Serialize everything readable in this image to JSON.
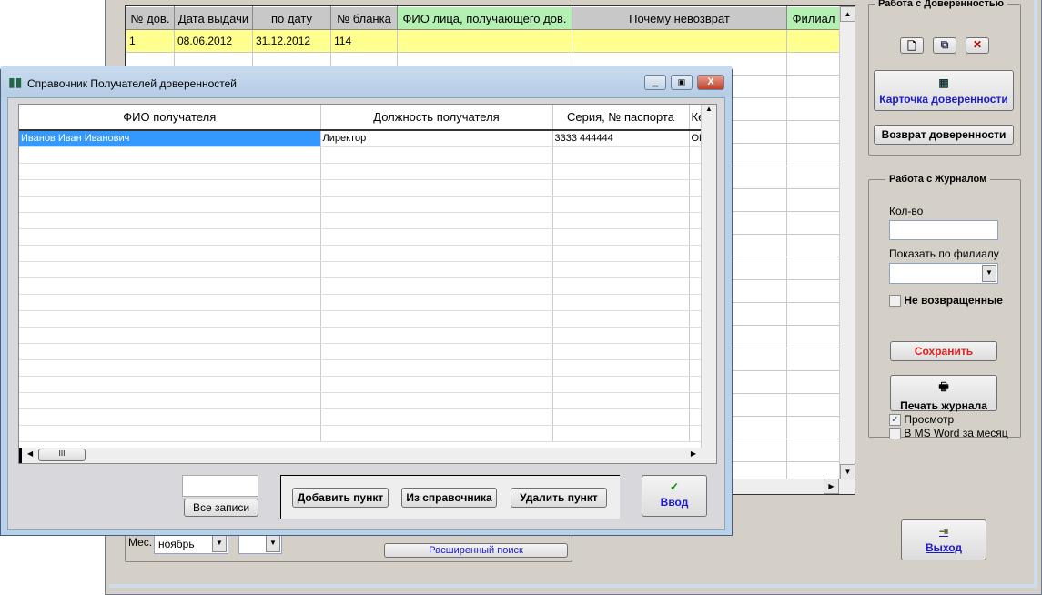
{
  "main": {
    "grid": {
      "columns": [
        "№ дов.",
        "Дата выдачи",
        "по дату",
        "№ бланка",
        "ФИО лица, получающего дов.",
        "Почему невозврат",
        "Филиал"
      ],
      "rows": [
        [
          "1",
          "08.06.2012",
          "31.12.2012",
          "114",
          "",
          "",
          ""
        ]
      ]
    },
    "group_poa": {
      "title": "Работа с Доверенностью",
      "card_label": "Карточка доверенности",
      "return_label": "Возврат доверенности"
    },
    "group_journal": {
      "title": "Работа с Журналом",
      "qty_label": "Кол-во",
      "qty_value": "",
      "branch_label": "Показать по филиалу",
      "branch_value": "",
      "not_returned_label": "Не возвращенные",
      "save_label": "Сохранить",
      "print_label": "Печать журнала",
      "preview_label": "Просмотр",
      "preview_checked": true,
      "word_label": "В MS Word за месяц",
      "word_checked": false
    },
    "exit_label": "Выход",
    "filter": {
      "month_label": "Мес.",
      "month_value": "ноябрь",
      "year_value": "",
      "advanced_search_label": "Расширенный поиск"
    },
    "colors": {
      "highlight_row": "#ffff90",
      "green_header": "#b4f0b4"
    }
  },
  "dialog": {
    "title": "Справочник Получателей доверенностей",
    "columns": [
      "ФИО получателя",
      "Должность получателя",
      "Серия, № паспорта",
      "Ке"
    ],
    "rows": [
      [
        "Иванов Иван Иванович",
        "Лиректор",
        "3333 444444",
        "ОВ"
      ]
    ],
    "filter_value": "",
    "all_records_label": "Все записи",
    "add_label": "Добавить пункт",
    "from_ref_label": "Из справочника",
    "delete_label": "Удалить пункт",
    "enter_label": "Ввод"
  }
}
